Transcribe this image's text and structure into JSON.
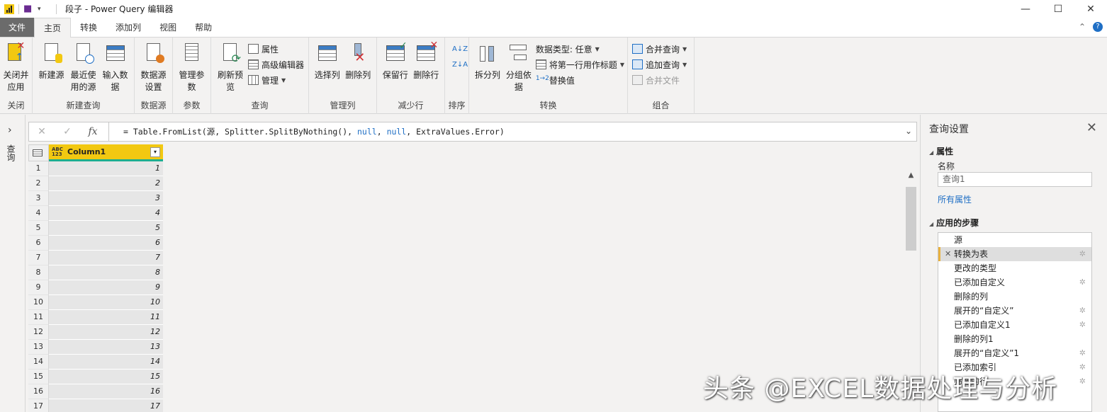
{
  "window": {
    "title": "段子 - Power Query 编辑器",
    "minimize": "—",
    "maximize": "☐",
    "close": "✕"
  },
  "tabs": {
    "file": "文件",
    "items": [
      "主页",
      "转换",
      "添加列",
      "视图",
      "帮助"
    ],
    "active": "主页",
    "collapse": "⌃",
    "help": "?"
  },
  "ribbon": {
    "close_group": {
      "label": "关闭",
      "close_apply": "关闭并应用"
    },
    "new_query_group": {
      "label": "新建查询",
      "new_source": "新建源",
      "recent_sources": "最近使用的源",
      "enter_data": "输入数据"
    },
    "data_source_group": {
      "label": "数据源",
      "settings": "数据源设置"
    },
    "params_group": {
      "label": "参数",
      "manage_params": "管理参数"
    },
    "query_group": {
      "label": "查询",
      "refresh": "刷新预览",
      "properties": "属性",
      "advanced_editor": "高级编辑器",
      "manage": "管理"
    },
    "manage_cols_group": {
      "label": "管理列",
      "choose_cols": "选择列",
      "remove_cols": "删除列"
    },
    "reduce_rows_group": {
      "label": "减少行",
      "keep_rows": "保留行",
      "remove_rows": "删除行"
    },
    "sort_group": {
      "label": "排序"
    },
    "transform_group": {
      "label": "转换",
      "split_col": "拆分列",
      "group_by": "分组依据",
      "data_type": "数据类型: 任意",
      "first_row_header": "将第一行用作标题",
      "replace_values": "替换值"
    },
    "combine_group": {
      "label": "组合",
      "merge_queries": "合并查询",
      "append_queries": "追加查询",
      "combine_files": "合并文件"
    }
  },
  "leftnav": {
    "label": "查询",
    "chevron": "›"
  },
  "formula_bar": {
    "cancel": "✕",
    "commit": "✓",
    "fx": "fx",
    "formula_prefix": "= Table.FromList(源, Splitter.SplitByNothing(), ",
    "kw1": "null",
    "mid": ", ",
    "kw2": "null",
    "formula_suffix": ", ExtraValues.Error)",
    "expand": "⌄"
  },
  "table": {
    "column_type": "ABC 123",
    "column_name": "Column1",
    "filter_icon": "▾",
    "rows": [
      {
        "n": "1",
        "v": "1"
      },
      {
        "n": "2",
        "v": "2"
      },
      {
        "n": "3",
        "v": "3"
      },
      {
        "n": "4",
        "v": "4"
      },
      {
        "n": "5",
        "v": "5"
      },
      {
        "n": "6",
        "v": "6"
      },
      {
        "n": "7",
        "v": "7"
      },
      {
        "n": "8",
        "v": "8"
      },
      {
        "n": "9",
        "v": "9"
      },
      {
        "n": "10",
        "v": "10"
      },
      {
        "n": "11",
        "v": "11"
      },
      {
        "n": "12",
        "v": "12"
      },
      {
        "n": "13",
        "v": "13"
      },
      {
        "n": "14",
        "v": "14"
      },
      {
        "n": "15",
        "v": "15"
      },
      {
        "n": "16",
        "v": "16"
      },
      {
        "n": "17",
        "v": "17"
      }
    ]
  },
  "query_settings": {
    "title": "查询设置",
    "close": "✕",
    "properties_header": "属性",
    "name_label": "名称",
    "name_value": "查询1",
    "all_properties": "所有属性",
    "steps_header": "应用的步骤",
    "steps": [
      {
        "label": "源",
        "gear": false,
        "selected": false
      },
      {
        "label": "转换为表",
        "gear": true,
        "selected": true
      },
      {
        "label": "更改的类型",
        "gear": false,
        "selected": false
      },
      {
        "label": "已添加自定义",
        "gear": true,
        "selected": false
      },
      {
        "label": "删除的列",
        "gear": false,
        "selected": false
      },
      {
        "label": "展开的“自定义”",
        "gear": true,
        "selected": false
      },
      {
        "label": "已添加自定义1",
        "gear": true,
        "selected": false
      },
      {
        "label": "删除的列1",
        "gear": false,
        "selected": false
      },
      {
        "label": "展开的“自定义”1",
        "gear": true,
        "selected": false
      },
      {
        "label": "已添加索引",
        "gear": true,
        "selected": false
      },
      {
        "label": "筛选的行",
        "gear": true,
        "selected": false
      }
    ]
  },
  "watermark": "头条 @EXCEL数据处理与分析"
}
